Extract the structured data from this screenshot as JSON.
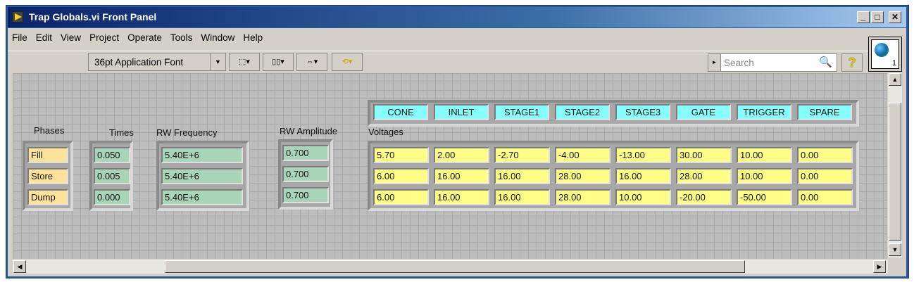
{
  "window": {
    "title": "Trap Globals.vi Front Panel",
    "min": "_",
    "max": "□",
    "close": "✕"
  },
  "menu": [
    "File",
    "Edit",
    "View",
    "Project",
    "Operate",
    "Tools",
    "Window",
    "Help"
  ],
  "toolbar": {
    "font": "36pt Application Font",
    "search_placeholder": "Search",
    "help": "?",
    "vi_icon_number": "1",
    "tools": [
      "align-objects",
      "distribute-objects",
      "resize-objects",
      "reorder"
    ]
  },
  "panel": {
    "phases": {
      "label": "Phases",
      "values": [
        "Fill",
        "Store",
        "Dump"
      ]
    },
    "times": {
      "label": "Times",
      "values": [
        "0.050",
        "0.005",
        "0.000"
      ]
    },
    "rw_frequency": {
      "label": "RW Frequency",
      "values": [
        "5.40E+6",
        "5.40E+6",
        "5.40E+6"
      ]
    },
    "rw_amplitude": {
      "label": "RW Amplitude",
      "values": [
        "0.700",
        "0.700",
        "0.700"
      ]
    },
    "voltages": {
      "label": "Voltages",
      "columns": [
        "CONE",
        "INLET",
        "STAGE1",
        "STAGE2",
        "STAGE3",
        "GATE",
        "TRIGGER",
        "SPARE"
      ],
      "rows": [
        [
          "5.70",
          "2.00",
          "-2.70",
          "-4.00",
          "-13.00",
          "30.00",
          "10.00",
          "0.00"
        ],
        [
          "6.00",
          "16.00",
          "16.00",
          "28.00",
          "16.00",
          "28.00",
          "10.00",
          "0.00"
        ],
        [
          "6.00",
          "16.00",
          "16.00",
          "28.00",
          "10.00",
          "-20.00",
          "-50.00",
          "0.00"
        ]
      ]
    }
  },
  "colors": {
    "string": "#ffe29a",
    "numeric": "#a8d4b8",
    "voltage": "#ffff88",
    "header": "#88ffff"
  }
}
